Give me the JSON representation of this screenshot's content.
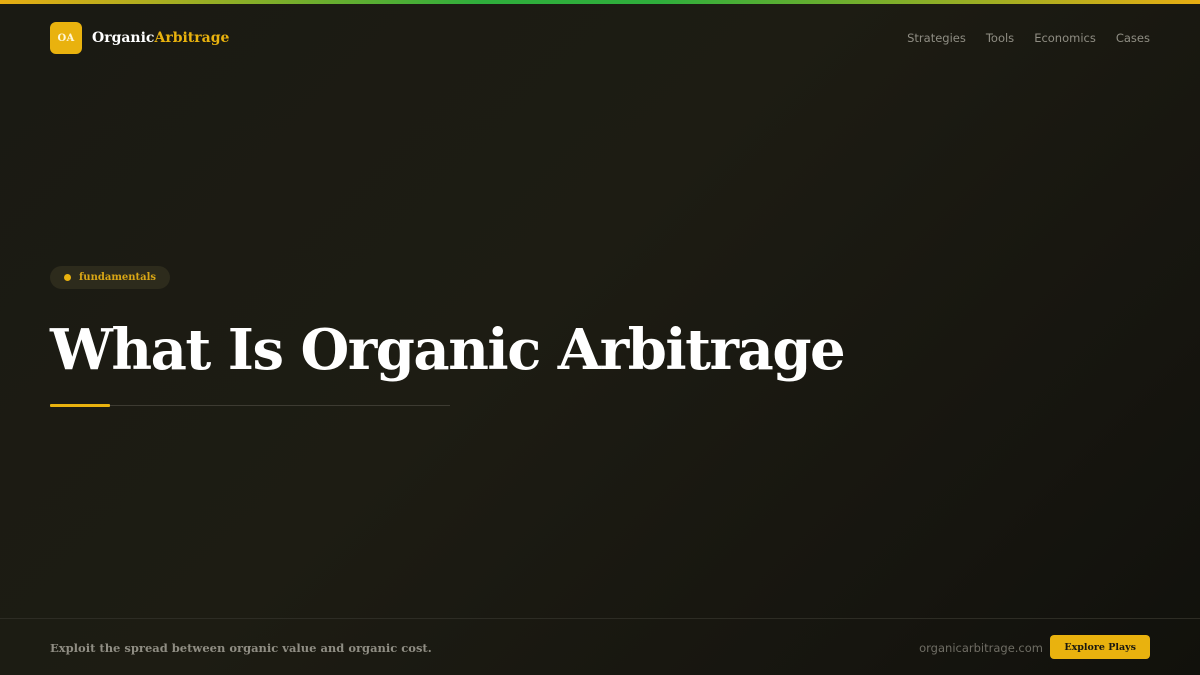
{
  "header": {
    "logo_badge": "OA",
    "logo_name_part1": "Organic",
    "logo_name_part2": "Arbitrage",
    "nav": [
      "Strategies",
      "Tools",
      "Economics",
      "Cases"
    ]
  },
  "hero": {
    "tag": "fundamentals",
    "title": "What Is Organic Arbitrage"
  },
  "footer": {
    "tagline": "Exploit the spread between organic value and organic cost.",
    "domain": "organicarbitrage.com",
    "cta_label": "Explore Plays"
  },
  "colors": {
    "accent": "#e9b20e",
    "accent_green": "#2fae3c",
    "background": "#1d1c13",
    "heading_text": "#ffffff",
    "muted_text": "#8f8d83"
  }
}
